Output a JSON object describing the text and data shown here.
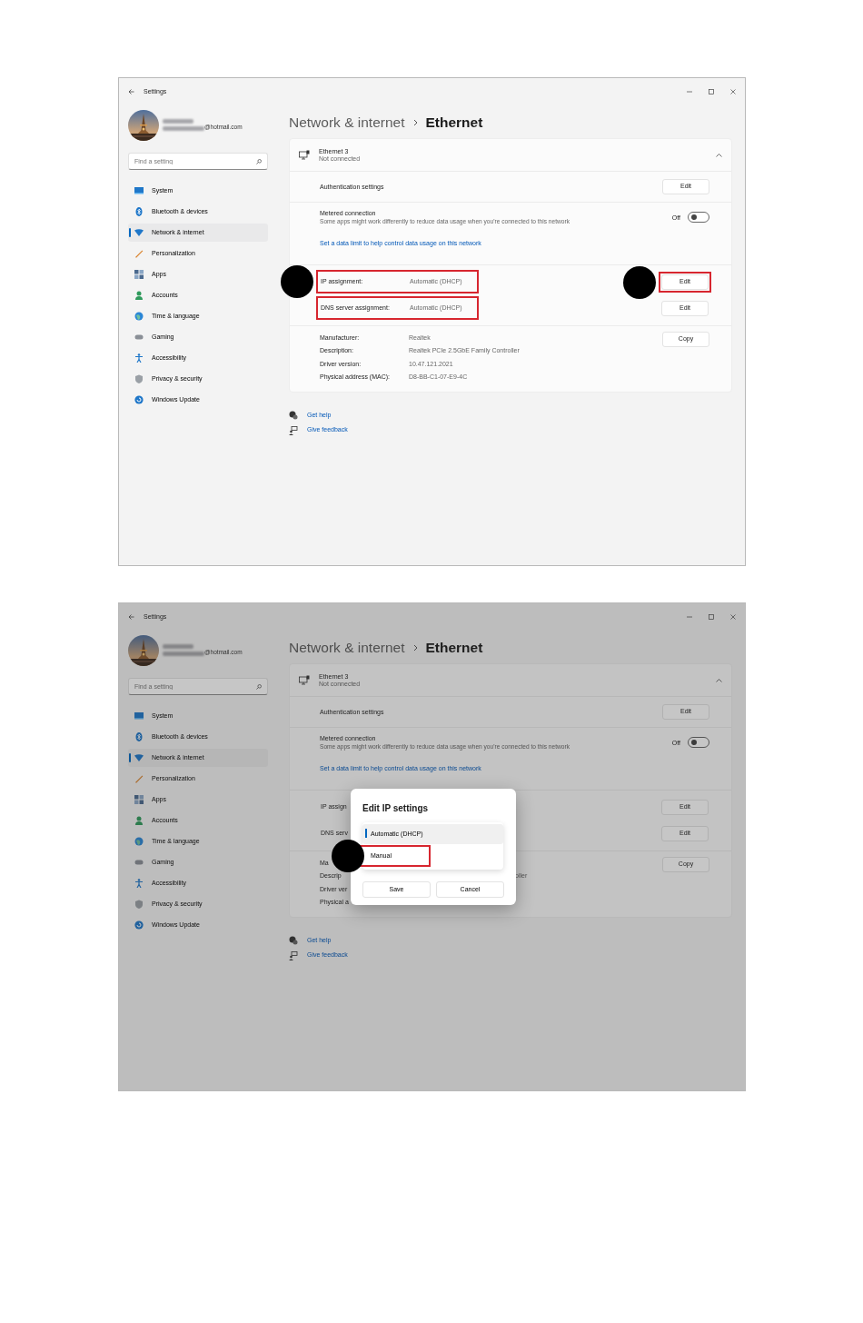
{
  "windows": [
    {
      "title": "Settings",
      "dimmed": false,
      "account": {
        "email": "@hotmail.com"
      },
      "search": {
        "placeholder": "Find a setting"
      },
      "nav": [
        {
          "label": "System",
          "selected": false
        },
        {
          "label": "Bluetooth & devices",
          "selected": false
        },
        {
          "label": "Network & internet",
          "selected": true
        },
        {
          "label": "Personalization",
          "selected": false
        },
        {
          "label": "Apps",
          "selected": false
        },
        {
          "label": "Accounts",
          "selected": false
        },
        {
          "label": "Time & language",
          "selected": false
        },
        {
          "label": "Gaming",
          "selected": false
        },
        {
          "label": "Accessibility",
          "selected": false
        },
        {
          "label": "Privacy & security",
          "selected": false
        },
        {
          "label": "Windows Update",
          "selected": false
        }
      ],
      "breadcrumb": {
        "parent": "Network & internet",
        "current": "Ethernet"
      },
      "adapter": {
        "name": "Ethernet 3",
        "status": "Not connected",
        "expanded": true
      },
      "auth": {
        "label": "Authentication settings",
        "button": "Edit"
      },
      "metered": {
        "title": "Metered connection",
        "description": "Some apps might work differently to reduce data usage when you're connected to this network",
        "state_label": "Off",
        "on": false,
        "link": "Set a data limit to help control data usage on this network"
      },
      "assignments": [
        {
          "label": "IP assignment:",
          "value": "Automatic (DHCP)",
          "button": "Edit",
          "highlighted": true,
          "callout": true,
          "button_highlighted": true,
          "button_callout": true
        },
        {
          "label": "DNS server assignment:",
          "value": "Automatic (DHCP)",
          "button": "Edit",
          "highlighted": true,
          "callout": false,
          "button_highlighted": false,
          "button_callout": false
        }
      ],
      "details": [
        {
          "label": "Manufacturer:",
          "value": "Realtek"
        },
        {
          "label": "Description:",
          "value": "Realtek PCIe 2.5GbE Family Controller"
        },
        {
          "label": "Driver version:",
          "value": "10.47.121.2021"
        },
        {
          "label": "Physical address (MAC):",
          "value": "D8-BB-C1-07-E9-4C"
        }
      ],
      "copy_button": "Copy",
      "links": [
        "Get help",
        "Give feedback"
      ]
    },
    {
      "title": "Settings",
      "dimmed": true,
      "account": {
        "email": "@hotmail.com"
      },
      "search": {
        "placeholder": "Find a setting"
      },
      "nav": [
        {
          "label": "System",
          "selected": false
        },
        {
          "label": "Bluetooth & devices",
          "selected": false
        },
        {
          "label": "Network & internet",
          "selected": true
        },
        {
          "label": "Personalization",
          "selected": false
        },
        {
          "label": "Apps",
          "selected": false
        },
        {
          "label": "Accounts",
          "selected": false
        },
        {
          "label": "Time & language",
          "selected": false
        },
        {
          "label": "Gaming",
          "selected": false
        },
        {
          "label": "Accessibility",
          "selected": false
        },
        {
          "label": "Privacy & security",
          "selected": false
        },
        {
          "label": "Windows Update",
          "selected": false
        }
      ],
      "breadcrumb": {
        "parent": "Network & internet",
        "current": "Ethernet"
      },
      "adapter": {
        "name": "Ethernet 3",
        "status": "Not connected",
        "expanded": true
      },
      "auth": {
        "label": "Authentication settings",
        "button": "Edit"
      },
      "metered": {
        "title": "Metered connection",
        "description": "Some apps might work differently to reduce data usage when you're connected to this network",
        "state_label": "Off",
        "on": false,
        "link": "Set a data limit to help control data usage on this network"
      },
      "assignments": [
        {
          "label": "IP assign",
          "button": "Edit",
          "highlighted": false,
          "callout": false,
          "button_highlighted": false,
          "button_callout": false
        },
        {
          "label": "DNS serv",
          "button": "Edit",
          "highlighted": false,
          "callout": false,
          "button_highlighted": false,
          "button_callout": false
        }
      ],
      "details": [
        {
          "label": "Ma"
        },
        {
          "label": "Descrip",
          "value": "oller"
        },
        {
          "label": "Driver ver"
        },
        {
          "label": "Physical a"
        }
      ],
      "copy_button": "Copy",
      "links": [
        "Get help",
        "Give feedback"
      ],
      "dialog": {
        "title": "Edit IP settings",
        "options": [
          {
            "label": "Automatic (DHCP)",
            "selected": true
          },
          {
            "label": "Manual",
            "selected": false,
            "highlighted": true,
            "callout": true
          }
        ],
        "buttons": [
          "Save",
          "Cancel"
        ]
      }
    }
  ]
}
